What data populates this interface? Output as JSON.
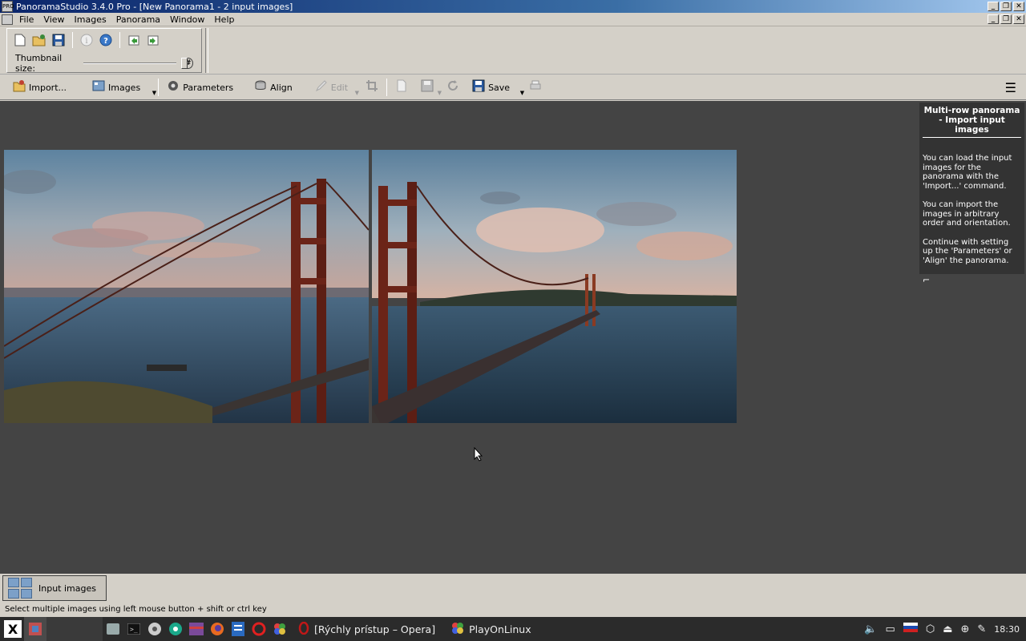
{
  "window": {
    "title": "PanoramaStudio 3.4.0 Pro - [New Panorama1 - 2 input images]"
  },
  "menu": [
    "File",
    "View",
    "Images",
    "Panorama",
    "Window",
    "Help"
  ],
  "top_toolbar": {
    "icons": [
      "new-icon",
      "open-icon",
      "save-icon",
      "info-icon",
      "help-icon",
      "undo-icon",
      "redo-icon"
    ],
    "thumbnail_label": "Thumbnail size:",
    "thumbnail_value": 1.0,
    "hash_label": "#"
  },
  "main_toolbar": {
    "import": "Import...",
    "images": "Images",
    "parameters": "Parameters",
    "align": "Align",
    "edit": "Edit",
    "save": "Save"
  },
  "help_panel": {
    "title": "Multi-row panorama - Import input images",
    "paragraphs": [
      "You can load the input images for the panorama with the 'Import...' command.",
      "You can import the images in arbitrary order and orientation.",
      "Continue with setting up the 'Parameters' or 'Align' the panorama."
    ]
  },
  "bottom_tabs": {
    "input_images": "Input images"
  },
  "status": "Select multiple images using left mouse button + shift or ctrl key",
  "taskbar": {
    "windows": [
      "[Rýchly prístup – Opera]",
      "PlayOnLinux"
    ],
    "clock": "18:30"
  }
}
